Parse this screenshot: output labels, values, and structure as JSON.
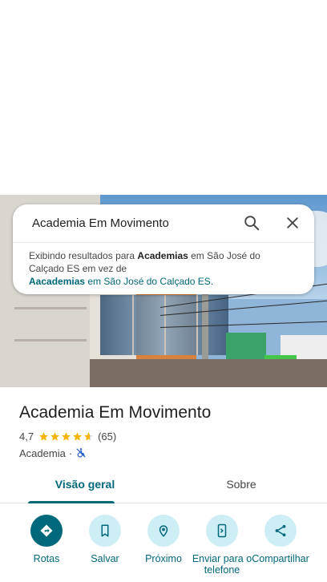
{
  "search": {
    "query": "Academia Em Movimento",
    "note_prefix": "Exibindo resultados para ",
    "note_term": "Academias",
    "note_middle": " em São José do Calçado ES em vez de",
    "note_alt_term": "Aacademias",
    "note_alt_rest": " em São José do Calçado ES."
  },
  "place": {
    "name": "Academia Em Movimento",
    "rating": "4,7",
    "rating_value": 4.7,
    "reviews": "(65)",
    "category": "Academia",
    "separator": "·"
  },
  "tabs": [
    {
      "label": "Visão geral",
      "selected": true
    },
    {
      "label": "Sobre",
      "selected": false
    }
  ],
  "actions": [
    {
      "label": "Rotas",
      "icon": "directions-icon"
    },
    {
      "label": "Salvar",
      "icon": "bookmark-icon"
    },
    {
      "label": "Próximo",
      "icon": "nearby-icon"
    },
    {
      "label": "Enviar para o telefone",
      "icon": "send-to-phone-icon"
    },
    {
      "label": "Compartilhar",
      "icon": "share-icon"
    }
  ],
  "colors": {
    "accent": "#00687b",
    "accent_light": "#cdeef4",
    "star": "#f4b400"
  }
}
